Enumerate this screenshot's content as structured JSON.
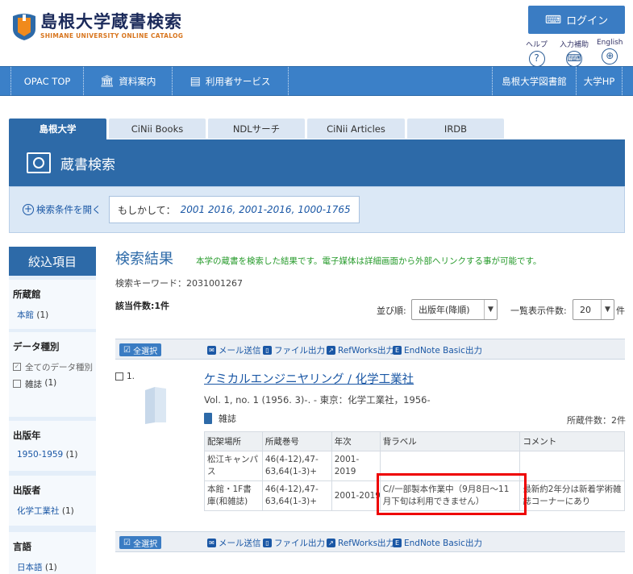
{
  "header": {
    "logo_title": "島根大学蔵書検索",
    "logo_sub": "SHIMANE UNIVERSITY ONLINE CATALOG",
    "login_label": "ログイン",
    "util": [
      {
        "label": "ヘルプ",
        "icon": "?"
      },
      {
        "label": "入力補助",
        "icon": "⌨"
      },
      {
        "label": "English",
        "icon": "⊕"
      }
    ]
  },
  "nav": {
    "opac_top": "OPAC TOP",
    "guide": "資料案内",
    "user_service": "利用者サービス",
    "library": "島根大学図書館",
    "univ": "大学HP"
  },
  "tabs": [
    "島根大学",
    "CiNii Books",
    "NDLサーチ",
    "CiNii Articles",
    "IRDB"
  ],
  "search": {
    "title": "蔵書検索",
    "open_conditions": "検索条件を開く",
    "suggest_label": "もしかして：",
    "suggestions": "2001 2016,  2001-2016,  1000-1765"
  },
  "sidebar": {
    "heading": "絞込項目",
    "holding_title": "所蔵館",
    "holding_item": "本館",
    "holding_count": "(1)",
    "datatype_title": "データ種別",
    "datatype_all": "全てのデータ種別",
    "datatype_journal": "雑誌",
    "datatype_journal_count": "(1)",
    "year_title": "出版年",
    "year_item": "1950-1959",
    "year_count": "(1)",
    "publisher_title": "出版者",
    "publisher_item": "化学工業社",
    "publisher_count": "(1)",
    "lang_title": "言語",
    "lang_item": "日本語",
    "lang_count": "(1)"
  },
  "results": {
    "title": "検索結果",
    "note": "本学の蔵書を検索した結果です。電子媒体は詳細画面から外部へリンクする事が可能です。",
    "keyword": "検索キーワード：2031001267",
    "hits": "該当件数:1件",
    "sort_label": "並び順:",
    "sort_value": "出版年(降順)",
    "perpage_label": "一覧表示件数:",
    "perpage_value": "20",
    "ken": "件",
    "select_all": "全選択",
    "mail": "メール送信",
    "file": "ファイル出力",
    "refworks": "RefWorks出力",
    "endnote": "EndNote Basic出力",
    "item": {
      "number": "1.",
      "title": "ケミカルエンジニヤリング / 化学工業社",
      "vol": "Vol. 1, no. 1 (1956. 3)-. - 東京：化学工業社，1956-",
      "type": "雑誌",
      "holdings_count": "所蔵件数：2件",
      "table_headers": [
        "配架場所",
        "所蔵巻号",
        "年次",
        "背ラベル",
        "コメント"
      ],
      "rows": [
        [
          "松江キャンパス",
          "46(4-12),47-63,64(1-3)+",
          "2001-2019",
          "",
          ""
        ],
        [
          "本館・1F書庫(和雑誌)",
          "46(4-12),47-63,64(1-3)+",
          "2001-2019",
          "C//一部製本作業中（9月8日～11月下旬は利用できません）",
          "最新約2年分は新着学術雑誌コーナーにあり"
        ]
      ]
    }
  }
}
